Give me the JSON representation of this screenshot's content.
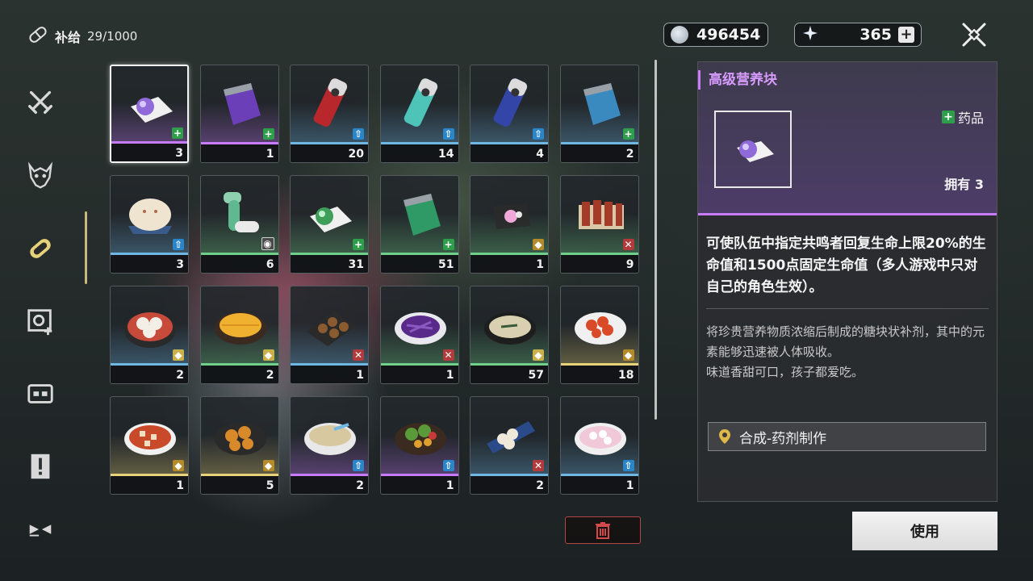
{
  "header": {
    "supply_label": "补给",
    "supply_count": "29/1000",
    "currency1": "496454",
    "currency2": "365",
    "currency2_plus": "+"
  },
  "sidebar": [
    {
      "name": "sidebar-weapons",
      "icon": "crossed-swords-icon",
      "active": false
    },
    {
      "name": "sidebar-echo",
      "icon": "demon-mask-icon",
      "active": false
    },
    {
      "name": "sidebar-supply",
      "icon": "pill-icon",
      "active": true
    },
    {
      "name": "sidebar-material",
      "icon": "gear-plus-icon",
      "active": false
    },
    {
      "name": "sidebar-resource",
      "icon": "box-icon",
      "active": false
    },
    {
      "name": "sidebar-quest",
      "icon": "exclamation-card-icon",
      "active": false
    },
    {
      "name": "sidebar-special",
      "icon": "bowtie-icon",
      "active": false
    }
  ],
  "items": [
    {
      "qty": "3",
      "rarity": "#c77bff",
      "tag": "heal",
      "art": "pill-purple",
      "selected": true
    },
    {
      "qty": "1",
      "rarity": "#c77bff",
      "tag": "heal",
      "art": "bag-purple"
    },
    {
      "qty": "20",
      "rarity": "#6fb8e6",
      "tag": "buff",
      "art": "can-red"
    },
    {
      "qty": "14",
      "rarity": "#6fb8e6",
      "tag": "buff",
      "art": "can-teal"
    },
    {
      "qty": "4",
      "rarity": "#6fb8e6",
      "tag": "buff",
      "art": "can-blue"
    },
    {
      "qty": "2",
      "rarity": "#6fb8e6",
      "tag": "heal",
      "art": "bag-blue"
    },
    {
      "qty": "3",
      "rarity": "#6fb8e6",
      "tag": "buff",
      "art": "bun"
    },
    {
      "qty": "6",
      "rarity": "#6fd08a",
      "tag": "spec",
      "art": "pipe"
    },
    {
      "qty": "31",
      "rarity": "#6fd08a",
      "tag": "heal",
      "art": "pill-green"
    },
    {
      "qty": "51",
      "rarity": "#6fd08a",
      "tag": "heal",
      "art": "bag-green"
    },
    {
      "qty": "1",
      "rarity": "#6fd08a",
      "tag": "gold",
      "art": "candy"
    },
    {
      "qty": "9",
      "rarity": "#6fd08a",
      "tag": "atk",
      "art": "skewers"
    },
    {
      "qty": "2",
      "rarity": "#6fb8e6",
      "tag": "def",
      "art": "dumplings"
    },
    {
      "qty": "2",
      "rarity": "#6fd08a",
      "tag": "def",
      "art": "omelette"
    },
    {
      "qty": "1",
      "rarity": "#6fb8e6",
      "tag": "atk",
      "art": "takoyaki"
    },
    {
      "qty": "1",
      "rarity": "#6fd08a",
      "tag": "atk",
      "art": "cabbage"
    },
    {
      "qty": "57",
      "rarity": "#6fd08a",
      "tag": "def",
      "art": "soup"
    },
    {
      "qty": "18",
      "rarity": "#e8d27a",
      "tag": "gold",
      "art": "chicken"
    },
    {
      "qty": "1",
      "rarity": "#e8d27a",
      "tag": "gold",
      "art": "tofu"
    },
    {
      "qty": "5",
      "rarity": "#e8d27a",
      "tag": "gold",
      "art": "fried"
    },
    {
      "qty": "2",
      "rarity": "#c77bff",
      "tag": "buff",
      "art": "noodles"
    },
    {
      "qty": "1",
      "rarity": "#c77bff",
      "tag": "buff",
      "art": "salad"
    },
    {
      "qty": "2",
      "rarity": "#6fb8e6",
      "tag": "atk",
      "art": "dimsum"
    },
    {
      "qty": "1",
      "rarity": "#6fb8e6",
      "tag": "buff",
      "art": "sweetsoup"
    }
  ],
  "detail": {
    "title": "高级营养块",
    "category": "药品",
    "owned": "拥有 3",
    "effect": "可使队伍中指定共鸣者回复生命上限20%的生命值和1500点固定生命值（多人游戏中只对自己的角色生效）。",
    "flavor_1": "将珍贵营养物质浓缩后制成的糖块状补剂，其中的元素能够迅速被人体吸收。",
    "flavor_2": "味道香甜可口，孩子都爱吃。",
    "source": "合成-药剂制作",
    "use_label": "使用"
  },
  "colors": {
    "accent_purple": "#c77bff",
    "tag_heal": "#2f9e4a",
    "tag_buff": "#2a86c8",
    "tag_attack": "#b23a3a"
  }
}
